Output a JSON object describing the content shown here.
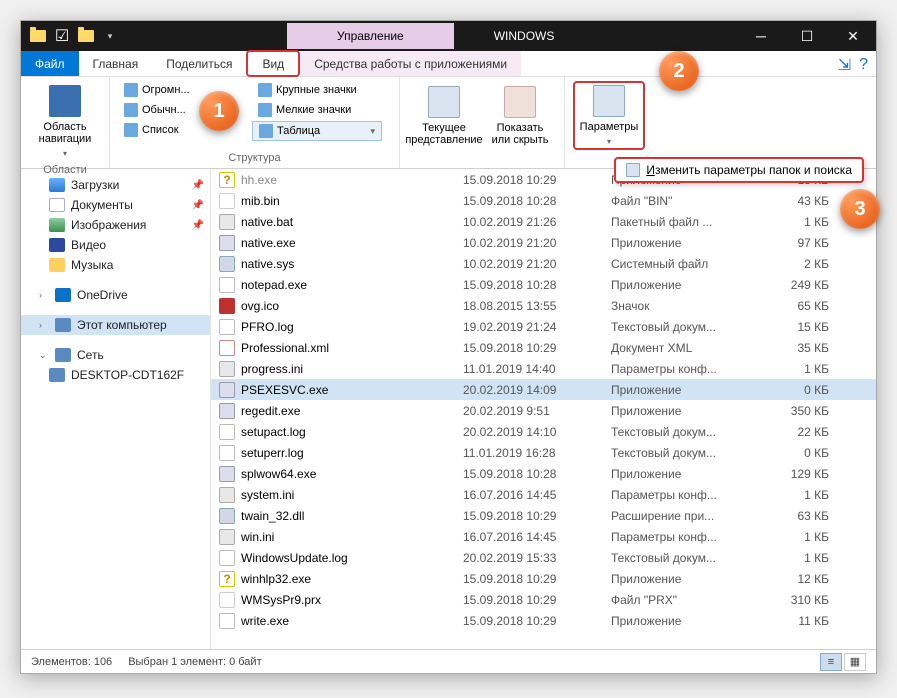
{
  "titlebar": {
    "context_tab": "Управление",
    "folder_name": "WINDOWS"
  },
  "tabs": {
    "file": "Файл",
    "home": "Главная",
    "share": "Поделиться",
    "view": "Вид",
    "apptools": "Средства работы с приложениями"
  },
  "ribbon": {
    "panes": {
      "navpane": "Область навигации",
      "group": "Области"
    },
    "layout": {
      "huge": "Огромн...",
      "normal": "Обычн...",
      "list": "Список",
      "large": "Крупные значки",
      "small": "Мелкие значки",
      "table": "Таблица",
      "group": "Структура"
    },
    "currentview": {
      "current": "Текущее представление",
      "show": "Показать или скрыть"
    },
    "options": {
      "label": "Параметры",
      "change": "Изменить параметры папок и поиска"
    }
  },
  "nav": {
    "downloads": "Загрузки",
    "documents": "Документы",
    "pictures": "Изображения",
    "videos": "Видео",
    "music": "Музыка",
    "onedrive": "OneDrive",
    "thispc": "Этот компьютер",
    "network": "Сеть",
    "host": "DESKTOP-CDT162F"
  },
  "files": [
    {
      "name": "hh.exe",
      "date": "15.09.2018 10:29",
      "type": "Приложение",
      "size": "18 КБ",
      "ico": "ic-q",
      "partial": true
    },
    {
      "name": "mib.bin",
      "date": "15.09.2018 10:28",
      "type": "Файл \"BIN\"",
      "size": "43 КБ",
      "ico": "ic-file"
    },
    {
      "name": "native.bat",
      "date": "10.02.2019 21:26",
      "type": "Пакетный файл ...",
      "size": "1 КБ",
      "ico": "ic-bat"
    },
    {
      "name": "native.exe",
      "date": "10.02.2019 21:20",
      "type": "Приложение",
      "size": "97 КБ",
      "ico": "ic-exe"
    },
    {
      "name": "native.sys",
      "date": "10.02.2019 21:20",
      "type": "Системный файл",
      "size": "2 КБ",
      "ico": "ic-sys"
    },
    {
      "name": "notepad.exe",
      "date": "15.09.2018 10:28",
      "type": "Приложение",
      "size": "249 КБ",
      "ico": "ic-txt"
    },
    {
      "name": "ovg.ico",
      "date": "18.08.2015 13:55",
      "type": "Значок",
      "size": "65 КБ",
      "ico": "ic-ico"
    },
    {
      "name": "PFRO.log",
      "date": "19.02.2019 21:24",
      "type": "Текстовый докум...",
      "size": "15 КБ",
      "ico": "ic-txt"
    },
    {
      "name": "Professional.xml",
      "date": "15.09.2018 10:29",
      "type": "Документ XML",
      "size": "35 КБ",
      "ico": "ic-xml"
    },
    {
      "name": "progress.ini",
      "date": "11.01.2019 14:40",
      "type": "Параметры конф...",
      "size": "1 КБ",
      "ico": "ic-ini"
    },
    {
      "name": "PSEXESVC.exe",
      "date": "20.02.2019 14:09",
      "type": "Приложение",
      "size": "0 КБ",
      "ico": "ic-exe",
      "sel": true
    },
    {
      "name": "regedit.exe",
      "date": "20.02.2019 9:51",
      "type": "Приложение",
      "size": "350 КБ",
      "ico": "ic-exe"
    },
    {
      "name": "setupact.log",
      "date": "20.02.2019 14:10",
      "type": "Текстовый докум...",
      "size": "22 КБ",
      "ico": "ic-txt"
    },
    {
      "name": "setuperr.log",
      "date": "11.01.2019 16:28",
      "type": "Текстовый докум...",
      "size": "0 КБ",
      "ico": "ic-txt"
    },
    {
      "name": "splwow64.exe",
      "date": "15.09.2018 10:28",
      "type": "Приложение",
      "size": "129 КБ",
      "ico": "ic-exe"
    },
    {
      "name": "system.ini",
      "date": "16.07.2016 14:45",
      "type": "Параметры конф...",
      "size": "1 КБ",
      "ico": "ic-ini"
    },
    {
      "name": "twain_32.dll",
      "date": "15.09.2018 10:29",
      "type": "Расширение при...",
      "size": "63 КБ",
      "ico": "ic-sys"
    },
    {
      "name": "win.ini",
      "date": "16.07.2016 14:45",
      "type": "Параметры конф...",
      "size": "1 КБ",
      "ico": "ic-ini"
    },
    {
      "name": "WindowsUpdate.log",
      "date": "20.02.2019 15:33",
      "type": "Текстовый докум...",
      "size": "1 КБ",
      "ico": "ic-txt"
    },
    {
      "name": "winhlp32.exe",
      "date": "15.09.2018 10:29",
      "type": "Приложение",
      "size": "12 КБ",
      "ico": "ic-q"
    },
    {
      "name": "WMSysPr9.prx",
      "date": "15.09.2018 10:29",
      "type": "Файл \"PRX\"",
      "size": "310 КБ",
      "ico": "ic-file"
    },
    {
      "name": "write.exe",
      "date": "15.09.2018 10:29",
      "type": "Приложение",
      "size": "11 КБ",
      "ico": "ic-txt"
    }
  ],
  "statusbar": {
    "count": "Элементов: 106",
    "selection": "Выбран 1 элемент: 0 байт"
  },
  "badges": {
    "b1": "1",
    "b2": "2",
    "b3": "3"
  }
}
